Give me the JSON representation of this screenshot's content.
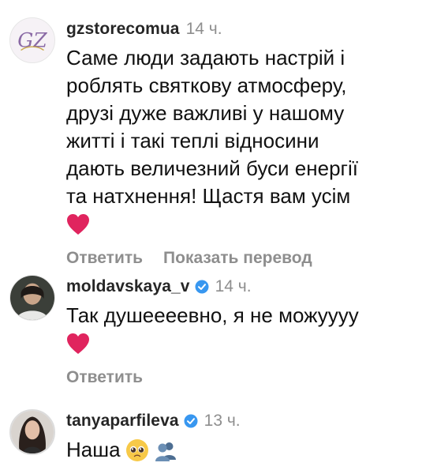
{
  "comments": [
    {
      "username": "gzstorecomua",
      "time": "14 ч.",
      "lines": [
        "Саме люди задають настрій і",
        "роблять святкову атмосферу,",
        "друзі дуже важливі у нашому",
        "житті і такі теплі відносини",
        "дають величезний буси енергії",
        "та натхнення! Щастя вам усім"
      ],
      "emoji": "heart-icon",
      "reply_label": "Ответить",
      "translate_label": "Показать перевод",
      "logo_text": "GZ"
    },
    {
      "username": "moldavskaya_v",
      "verified": true,
      "time": "14 ч.",
      "lines": [
        "Так душеееевно, я не можуууу"
      ],
      "emoji": "heart-icon",
      "reply_label": "Ответить"
    },
    {
      "username": "tanyaparfileva",
      "verified": true,
      "time": "13 ч.",
      "lines": [
        "Наша"
      ],
      "emojis": [
        "pleading-face-icon",
        "busts-in-silhouette-icon"
      ]
    }
  ],
  "colors": {
    "username": "#262626",
    "meta_gray": "#8e8e8e",
    "verified_blue": "#3897f0",
    "heart_red": "#e0245e"
  }
}
